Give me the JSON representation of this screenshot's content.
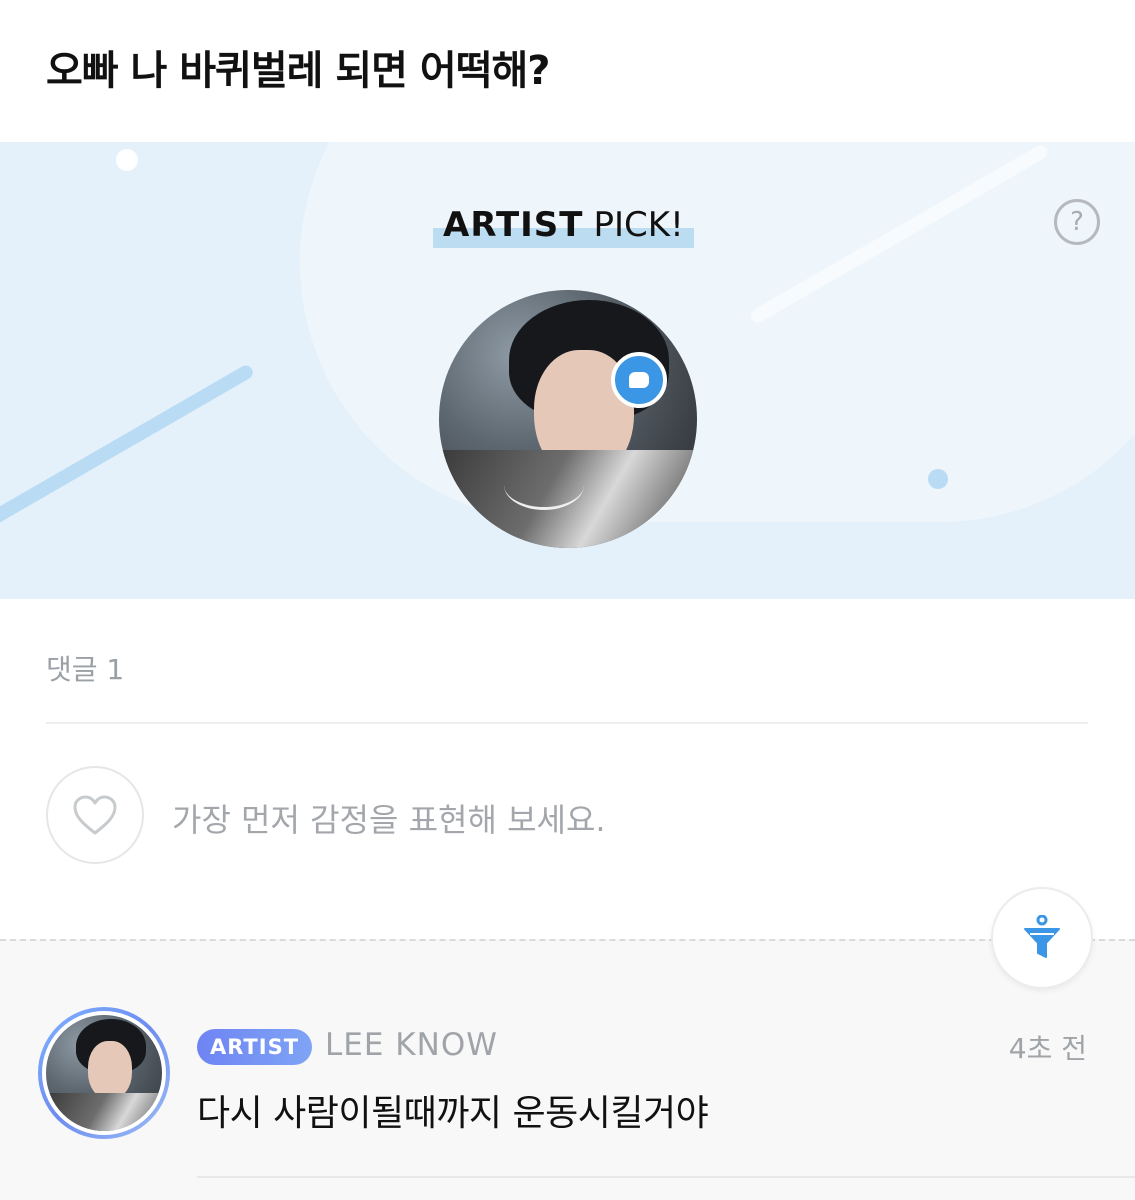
{
  "post": {
    "title": "오빠 나 바퀴벌레 되면 어떡해?"
  },
  "banner": {
    "pick_bold": "ARTIST",
    "pick_rest": "PICK!",
    "help_icon": "question-circle-icon",
    "help_glyph": "?",
    "badge_icon": "chat-bubble-icon"
  },
  "comments_header": {
    "count_label": "댓글 1"
  },
  "reaction": {
    "icon": "heart-icon",
    "prompt": "가장 먼저 감정을 표현해 보세요."
  },
  "filter": {
    "icon": "filter-icon"
  },
  "comments": [
    {
      "badge": "ARTIST",
      "author": "LEE KNOW",
      "time": "4초 전",
      "text": "다시 사람이될때까지 운동시킬거야"
    }
  ],
  "colors": {
    "accent_blue": "#3b97e6",
    "banner_bg": "#e4f1fa",
    "badge_gradient_start": "#6e84f3",
    "badge_gradient_end": "#7fa4f6",
    "muted_text": "#a0a4a8"
  }
}
